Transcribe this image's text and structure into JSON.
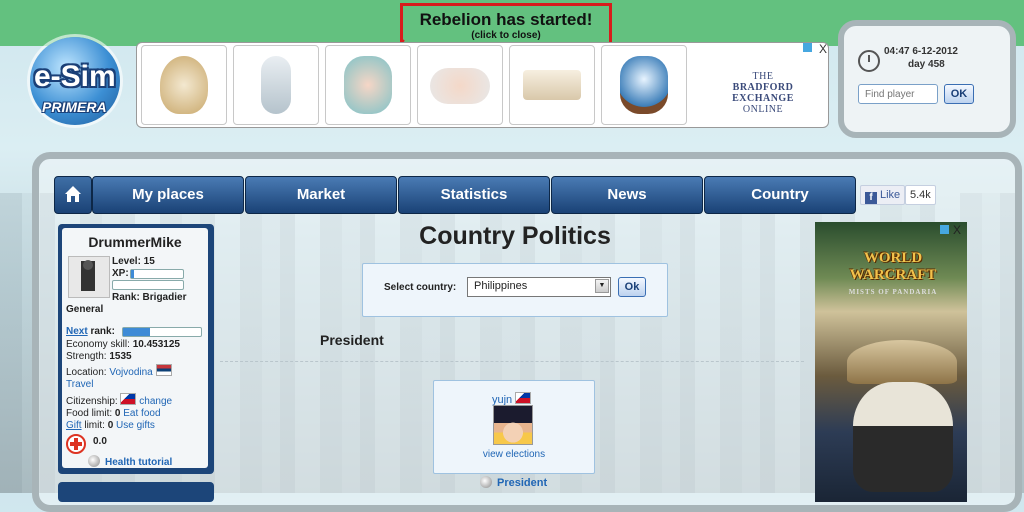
{
  "notification": {
    "title": "Rebelion has started!",
    "subtitle": "(click to close)"
  },
  "logo": {
    "line1": "e-Sim",
    "line2": "PRIMERA"
  },
  "ad_banner": {
    "brand_line1": "THE",
    "brand_line2": "BRADFORD EXCHANGE",
    "brand_line3": "ONLINE",
    "close": "X"
  },
  "clock": {
    "time": "04:47 6-12-2012",
    "day": "day 458"
  },
  "find_player": {
    "placeholder": "Find player",
    "ok": "OK"
  },
  "nav": {
    "items": [
      "My places",
      "Market",
      "Statistics",
      "News",
      "Country"
    ]
  },
  "facebook": {
    "like": "Like",
    "count": "5.4k"
  },
  "profile": {
    "name": "DrummerMike",
    "level": "Level: 15",
    "xp_label": "XP:",
    "xp_progress": 0.05,
    "rank_text": "Rank: Brigadier",
    "rank_suffix": "General",
    "next_link": "Next",
    "next_rank_label": "rank:",
    "next_rank_progress": 0.35,
    "economy_label": "Economy skill:",
    "economy_value": "10.453125",
    "strength_label": "Strength:",
    "strength_value": "1535",
    "location_label": "Location:",
    "location_value": "Vojvodina",
    "travel_link": "Travel",
    "citizenship_label": "Citizenship:",
    "citizenship_link": "change",
    "food_label": "Food limit:",
    "food_value": "0",
    "eat_link": "Eat food",
    "gift_link": "Gift",
    "gift_label": "limit:",
    "gift_value": "0",
    "use_gifts": "Use gifts",
    "health_value": "0.0",
    "tutorial_link": "Health tutorial"
  },
  "main": {
    "title": "Country Politics",
    "select_label": "Select country:",
    "selected_country": "Philippines",
    "ok": "Ok",
    "section": "President",
    "president_name": "yujn",
    "view_elections": "view elections",
    "president_link": "President"
  },
  "right_ad": {
    "line1": "WORLD",
    "line2": "WARCRAFT",
    "tagline": "MISTS OF PANDARIA",
    "close": "X"
  }
}
